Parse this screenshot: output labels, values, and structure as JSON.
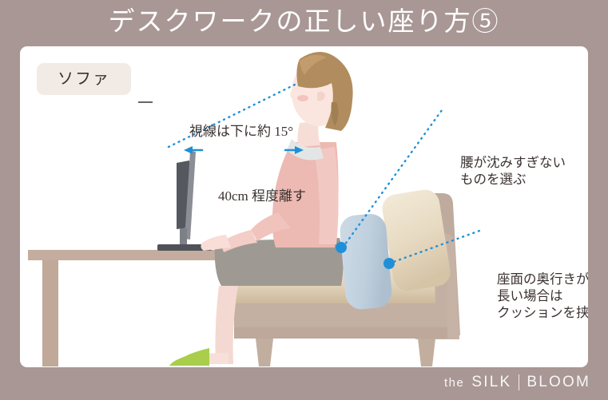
{
  "page": {
    "title": "デスクワークの正しい座り方⑤",
    "background_color": "#a89795",
    "card_color": "#ffffff"
  },
  "badge": {
    "label": "ソファ",
    "background_color": "#f2ebe5"
  },
  "annotations": [
    {
      "id": "eye-line",
      "lines": [
        "視線は下に約 15°"
      ]
    },
    {
      "id": "monitor-distance",
      "lines": [
        "40cm 程度離す"
      ],
      "arrow_left": "←",
      "arrow_right": "→"
    },
    {
      "id": "seat-firmness",
      "lines": [
        "腰が沈みすぎない",
        "ものを選ぶ"
      ]
    },
    {
      "id": "seat-depth",
      "lines": [
        "座面の奥行きが",
        "長い場合は",
        "クッションを挟む"
      ]
    }
  ],
  "illustration": {
    "description": "横から見た、ソファに座ってデスクワークをする女性",
    "accent_color": "#1f90d8",
    "desk_color": "#c4ad9e",
    "sofa_color": "#bfab9e",
    "cushion_color": "#e8dcc6",
    "lumbar_cushion_color": "#c3d4e1",
    "hair_color": "#b08c5e",
    "skin_color": "#f5ddd4",
    "top_color": "#edb9b3",
    "pants_color": "#9e9a93",
    "slipper_color": "#a8ce4b",
    "monitor_color": "#5d6066"
  },
  "footer": {
    "brand_the": "the",
    "brand_silk": "SILK",
    "brand_bloom": "BLOOM",
    "separator": "|"
  }
}
